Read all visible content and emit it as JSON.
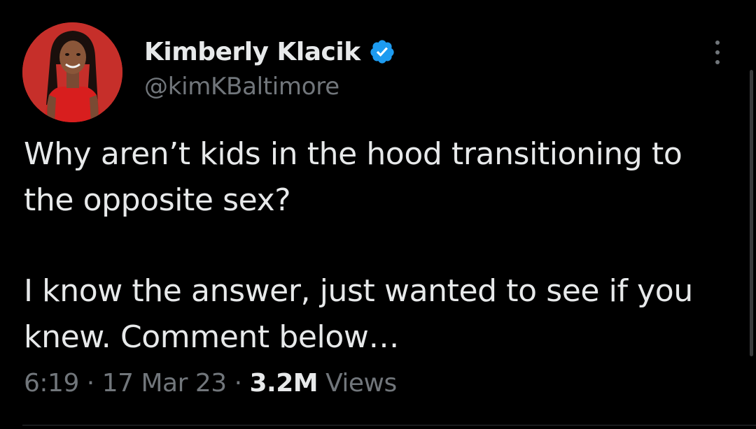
{
  "author": {
    "display_name": "Kimberly Klacik",
    "handle": "@kimKBaltimore",
    "verified": true,
    "verified_badge_color": "#1d9bf0",
    "avatar_background": "#c9302c"
  },
  "tweet": {
    "paragraphs": [
      "Why aren’t kids in the hood transitioning to\nthe opposite sex?",
      "I know the answer, just wanted to see if you\nknew. Comment below…"
    ],
    "time": "6:19",
    "separator": "·",
    "date": "17 Mar 23",
    "views_count": "3.2M",
    "views_label": "Views"
  },
  "icons": {
    "more": "more-options-icon",
    "verified": "verified-badge-icon"
  },
  "colors": {
    "background": "#000000",
    "primary_text": "#e7e9ea",
    "secondary_text": "#71767b",
    "divider": "#2f3336"
  }
}
